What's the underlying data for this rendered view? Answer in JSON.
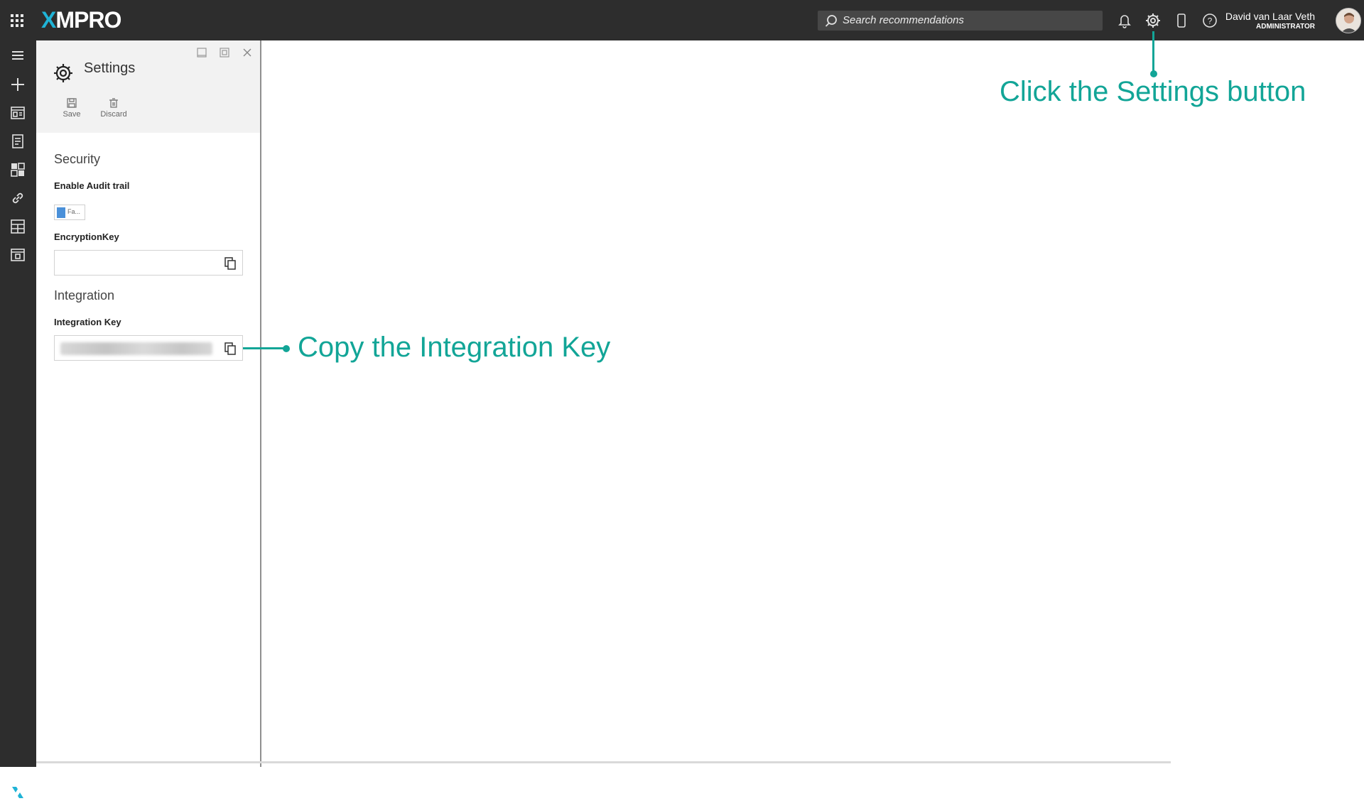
{
  "app": {
    "logo_text": "MPRO",
    "logo_x": "X",
    "accent_color": "#1fb3d6"
  },
  "header": {
    "search_placeholder": "Search recommendations",
    "icons": [
      "apps-grid-icon",
      "bell-icon",
      "gear-icon",
      "mobile-icon",
      "help-icon"
    ],
    "user": {
      "name": "David van Laar Veth",
      "role": "ADMINISTRATOR"
    }
  },
  "rail": {
    "icons": [
      "menu-icon",
      "plus-icon",
      "dashboard-icon",
      "report-icon",
      "widgets-icon",
      "link-icon",
      "grid-icon",
      "table-icon",
      "xmpro-x-icon"
    ]
  },
  "panel": {
    "title": "Settings",
    "toolbar": {
      "save_label": "Save",
      "discard_label": "Discard"
    },
    "security": {
      "heading": "Security",
      "audit_label": "Enable Audit trail",
      "audit_value": "Fa...",
      "encryption_label": "EncryptionKey",
      "encryption_value": ""
    },
    "integration": {
      "heading": "Integration",
      "key_label": "Integration Key"
    }
  },
  "annotations": {
    "settings_hint": "Click the Settings button",
    "integration_hint": "Copy the Integration Key",
    "color": "#12a597"
  }
}
